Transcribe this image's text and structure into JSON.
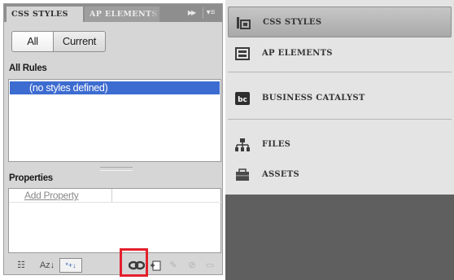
{
  "left_panel": {
    "tabs": [
      "CSS STYLES",
      "AP ELEMENTS"
    ],
    "collapse_icon": "double-chevron-right-icon",
    "menu_icon": "panel-menu-icon",
    "segments": [
      "All",
      "Current"
    ],
    "all_rules_title": "All Rules",
    "rule_item": "(no styles defined)",
    "properties_title": "Properties",
    "add_property": "Add Property",
    "toolbar": {
      "category_view_icon": "category-view-icon",
      "alpha_view_label": "Az↓",
      "set_properties_icon": "show-set-properties-icon",
      "attach_style_sheet_icon": "attach-style-sheet-icon",
      "new_css_rule_icon": "new-css-rule-icon",
      "edit_rule_icon": "edit-rule-icon",
      "disable_rule_icon": "disable-css-property-icon",
      "delete_rule_icon": "delete-css-rule-icon"
    },
    "highlight_color": "#e41f2c",
    "selection_color": "#3d6cd0"
  },
  "right_panel": {
    "items": [
      {
        "label": "CSS STYLES",
        "icon": "css-styles-icon"
      },
      {
        "label": "AP ELEMENTS",
        "icon": "ap-elements-icon"
      },
      {
        "label": "BUSINESS CATALYST",
        "icon": "business-catalyst-icon"
      },
      {
        "label": "FILES",
        "icon": "files-tree-icon"
      },
      {
        "label": "ASSETS",
        "icon": "assets-icon"
      }
    ]
  }
}
